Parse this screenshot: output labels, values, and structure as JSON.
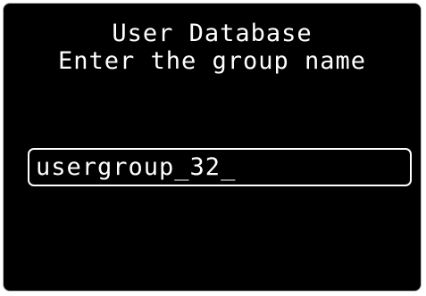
{
  "screen": {
    "title": "User Database",
    "prompt": "Enter the group name"
  },
  "input": {
    "value": "usergroup_32_"
  }
}
